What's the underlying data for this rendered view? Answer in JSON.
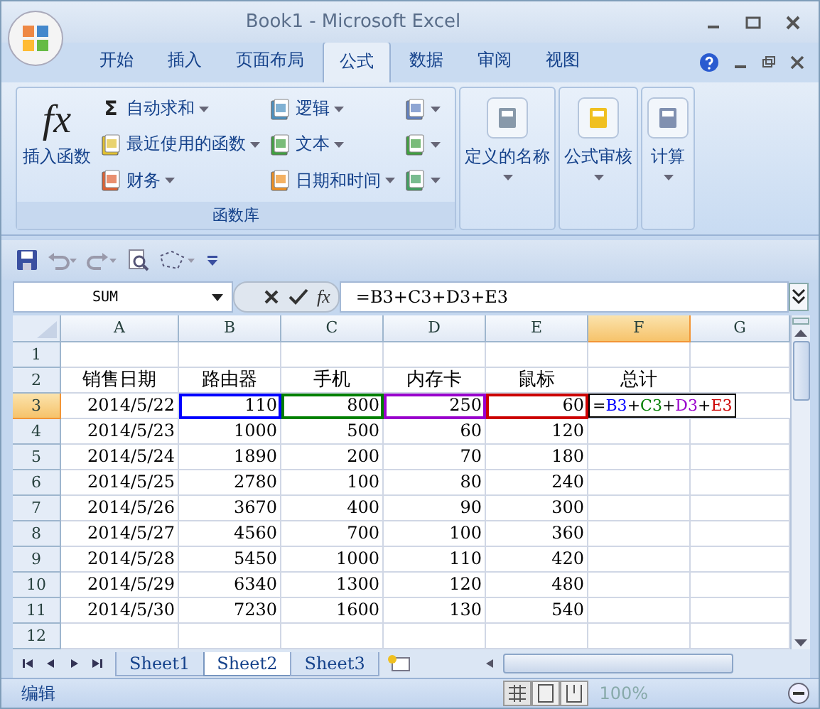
{
  "window": {
    "title": "Book1 - Microsoft Excel"
  },
  "tabs": [
    {
      "label": "开始",
      "selected": false
    },
    {
      "label": "插入",
      "selected": false
    },
    {
      "label": "页面布局",
      "selected": false
    },
    {
      "label": "公式",
      "selected": true
    },
    {
      "label": "数据",
      "selected": false
    },
    {
      "label": "审阅",
      "selected": false
    },
    {
      "label": "视图",
      "selected": false
    }
  ],
  "ribbon": {
    "insert_function": {
      "glyph": "fx",
      "label": "插入函数"
    },
    "function_columns": [
      [
        {
          "glyph": "Σ",
          "label": "自动求和"
        },
        {
          "label": "最近使用的函数"
        },
        {
          "label": "财务"
        }
      ],
      [
        {
          "label": "逻辑"
        },
        {
          "label": "文本"
        },
        {
          "label": "日期和时间"
        }
      ],
      [
        {},
        {},
        {}
      ]
    ],
    "group_label": "函数库",
    "groups": [
      {
        "label": "定义的名称"
      },
      {
        "label": "公式审核"
      },
      {
        "label": "计算"
      }
    ]
  },
  "formula_bar": {
    "name_box": "SUM",
    "fx": "fx",
    "formula": "=B3+C3+D3+E3"
  },
  "sheet": {
    "columns": [
      {
        "label": "A",
        "selected": false
      },
      {
        "label": "B",
        "selected": false
      },
      {
        "label": "C",
        "selected": false
      },
      {
        "label": "D",
        "selected": false
      },
      {
        "label": "E",
        "selected": false
      },
      {
        "label": "F",
        "selected": true
      },
      {
        "label": "G",
        "selected": false
      }
    ],
    "rows": [
      {
        "number": "1",
        "selected": false,
        "cells": [
          null,
          null,
          null,
          null,
          null,
          null,
          null
        ]
      },
      {
        "number": "2",
        "selected": false,
        "kind": "header",
        "cells": [
          "销售日期",
          "路由器",
          "手机",
          "内存卡",
          "鼠标",
          "总计",
          null
        ]
      },
      {
        "number": "3",
        "selected": true,
        "cells": [
          "2014/5/22",
          {
            "text": "110",
            "color": "#0000ff"
          },
          {
            "text": "800",
            "color": "#008000"
          },
          {
            "text": "250",
            "color": "#9900cc"
          },
          {
            "text": "60",
            "color": "#cc0000"
          },
          {
            "parts": [
              {
                "text": "=",
                "color": "#000000"
              },
              {
                "text": "B3",
                "color": "#0000ff"
              },
              {
                "text": "+",
                "color": "#000000"
              },
              {
                "text": "C3",
                "color": "#008000"
              },
              {
                "text": "+",
                "color": "#000000"
              },
              {
                "text": "D3",
                "color": "#9900cc"
              },
              {
                "text": "+",
                "color": "#000000"
              },
              {
                "text": "E3",
                "color": "#cc0000"
              }
            ]
          },
          null
        ]
      },
      {
        "number": "4",
        "selected": false,
        "cells": [
          "2014/5/23",
          "1000",
          "500",
          "60",
          "120",
          null,
          null
        ]
      },
      {
        "number": "5",
        "selected": false,
        "cells": [
          "2014/5/24",
          "1890",
          "200",
          "70",
          "180",
          null,
          null
        ]
      },
      {
        "number": "6",
        "selected": false,
        "cells": [
          "2014/5/25",
          "2780",
          "100",
          "80",
          "240",
          null,
          null
        ]
      },
      {
        "number": "7",
        "selected": false,
        "cells": [
          "2014/5/26",
          "3670",
          "400",
          "90",
          "300",
          null,
          null
        ]
      },
      {
        "number": "8",
        "selected": false,
        "cells": [
          "2014/5/27",
          "4560",
          "700",
          "100",
          "360",
          null,
          null
        ]
      },
      {
        "number": "9",
        "selected": false,
        "cells": [
          "2014/5/28",
          "5450",
          "1000",
          "110",
          "420",
          null,
          null
        ]
      },
      {
        "number": "10",
        "selected": false,
        "cells": [
          "2014/5/29",
          "6340",
          "1300",
          "120",
          "480",
          null,
          null
        ]
      },
      {
        "number": "11",
        "selected": false,
        "cells": [
          "2014/5/30",
          "7230",
          "1600",
          "130",
          "540",
          null,
          null
        ]
      },
      {
        "number": "12",
        "selected": false,
        "cells": [
          null,
          null,
          null,
          null,
          null,
          null,
          null
        ]
      }
    ]
  },
  "sheet_tabs": [
    {
      "label": "Sheet1",
      "selected": false
    },
    {
      "label": "Sheet2",
      "selected": true
    },
    {
      "label": "Sheet3",
      "selected": false
    }
  ],
  "status_bar": {
    "mode": "编辑",
    "zoom": "100%"
  }
}
